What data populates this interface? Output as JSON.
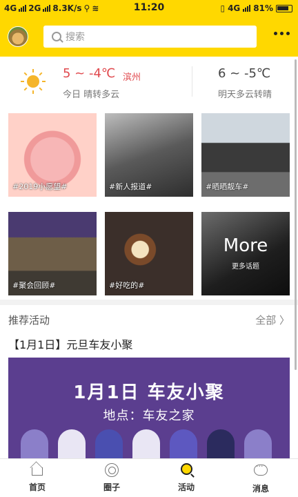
{
  "status_bar": {
    "network1": "4G",
    "network2": "2G",
    "speed": "8.3K/s",
    "time": "11:20",
    "network3": "4G",
    "battery": "81%"
  },
  "header": {
    "search_placeholder": "搜索"
  },
  "weather": {
    "today_temp": "5 ~ -4℃",
    "city": "滨州",
    "today_desc": "今日 晴转多云",
    "tomorrow_temp": "6 ~ -5℃",
    "tomorrow_desc": "明天多云转晴"
  },
  "topics": [
    {
      "label": "#2019小愿望#"
    },
    {
      "label": "#新人报道#"
    },
    {
      "label": "#晒晒靓车#"
    },
    {
      "label": "#聚会回顾#"
    },
    {
      "label": "#好吃的#"
    },
    {
      "label": "More",
      "sub": "更多话题"
    }
  ],
  "recommend": {
    "title": "推荐活动",
    "all": "全部 〉",
    "event_title": "【1月1日】元旦车友小聚",
    "banner_title": "1月1日  车友小聚",
    "banner_subtitle": "地点：车友之家"
  },
  "bottom_nav": [
    {
      "label": "首页",
      "icon": "home-icon"
    },
    {
      "label": "圈子",
      "icon": "circle-icon"
    },
    {
      "label": "活动",
      "icon": "activity-icon"
    },
    {
      "label": "消息",
      "icon": "message-icon"
    }
  ],
  "colors": {
    "brand_yellow": "#ffd800",
    "today_red": "#e0484d",
    "banner_purple": "#5b3e8f"
  }
}
